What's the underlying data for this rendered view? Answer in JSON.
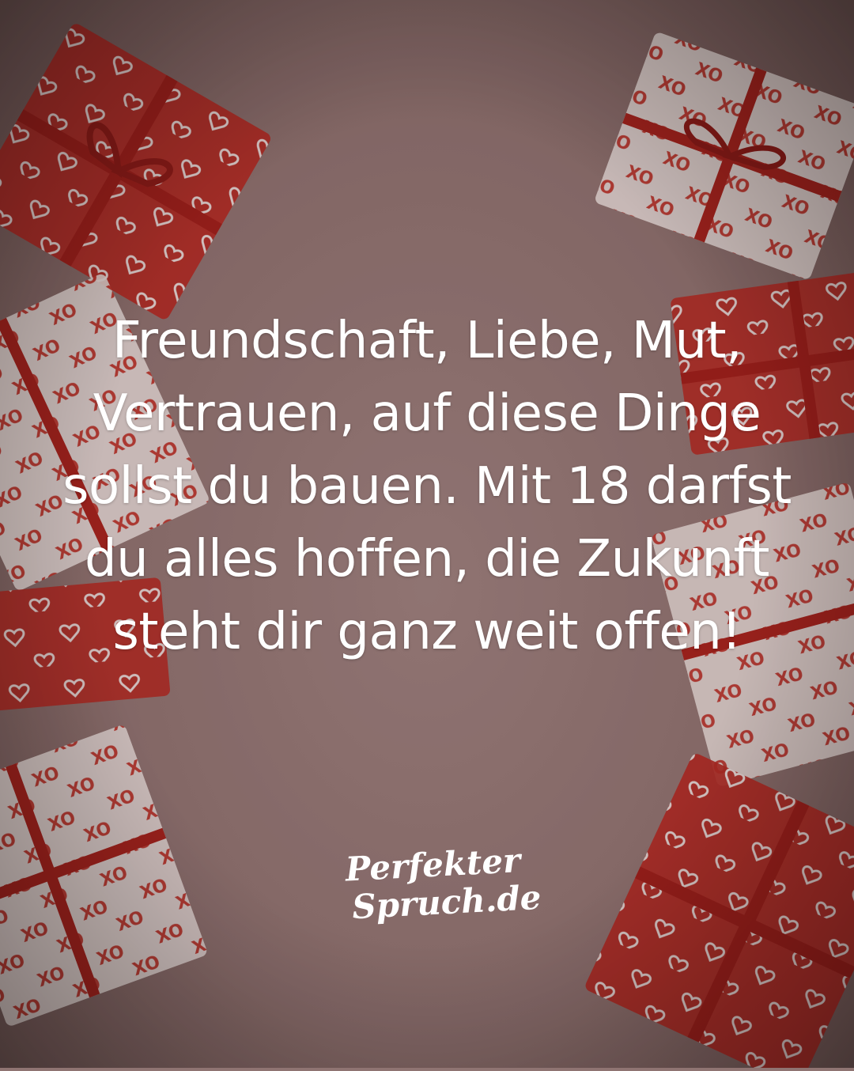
{
  "quote": {
    "text": "Freundschaft, Liebe, Mut, Vertrauen, auf diese Dinge sollst du bauen. Mit 18 darfst du alles hoffen, die Zukunft steht dir ganz weit offen!"
  },
  "logo": {
    "line1": "Perfekter",
    "line2": "Spruch.de"
  },
  "colors": {
    "background": "#8f7472",
    "gift_red": "#b3231c",
    "gift_white": "#ece4e2",
    "ribbon": "#9e1712",
    "text": "#ffffff"
  }
}
